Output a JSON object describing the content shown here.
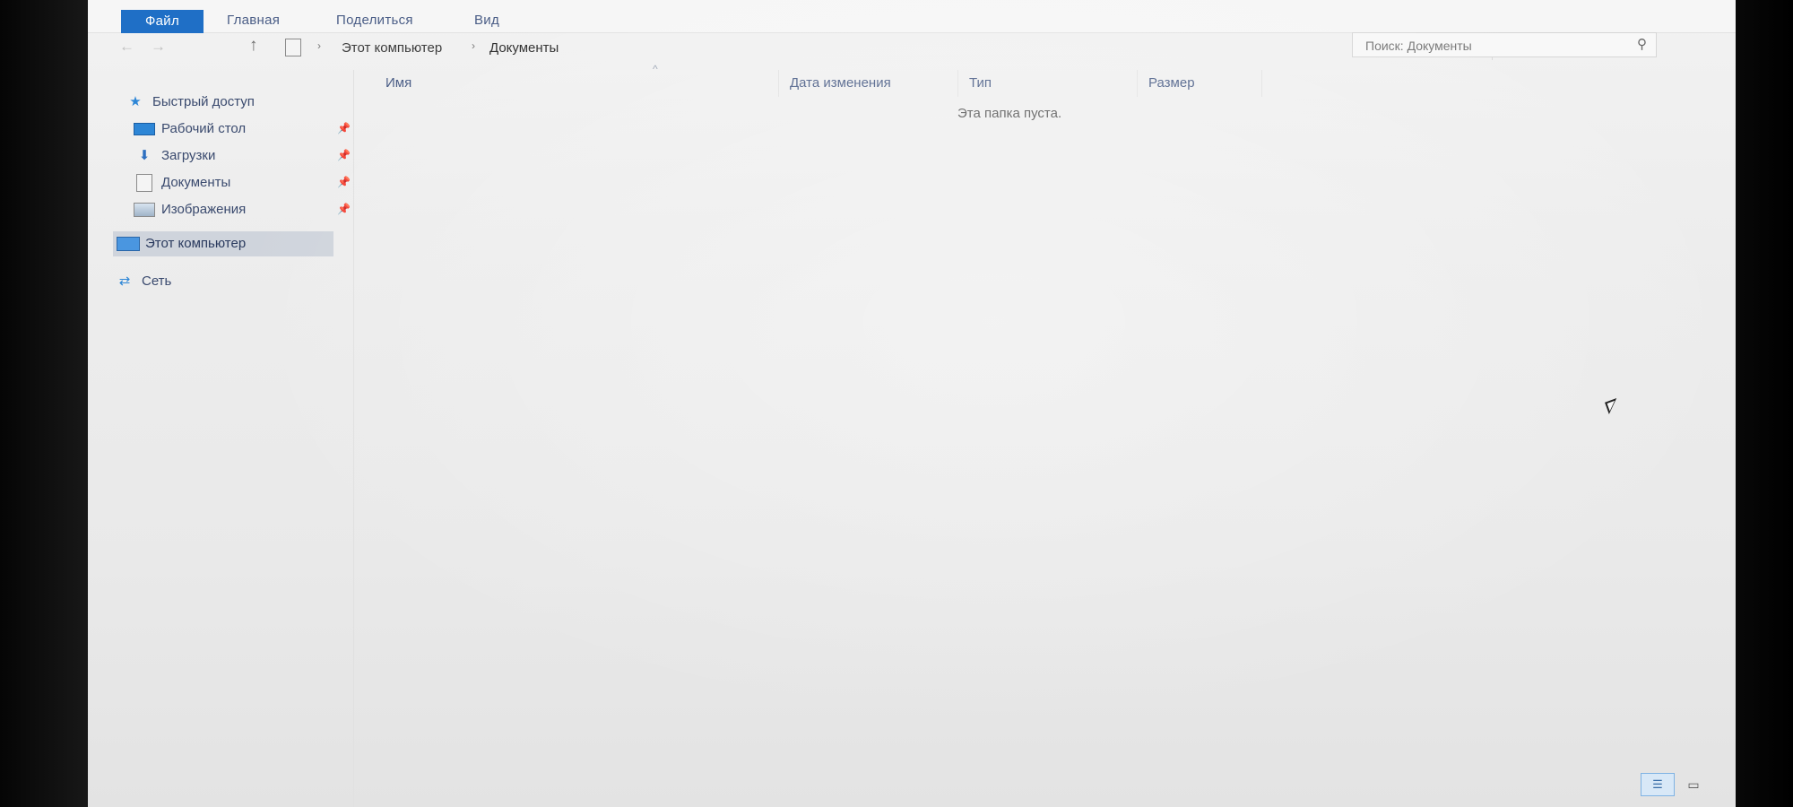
{
  "ribbon": {
    "tabs": [
      "Файл",
      "Главная",
      "Поделиться",
      "Вид"
    ]
  },
  "address": {
    "crumbs": [
      "Этот компьютер",
      "Документы"
    ],
    "separator": "›"
  },
  "search": {
    "placeholder": "Поиск: Документы"
  },
  "navpane": {
    "quick_access": "Быстрый доступ",
    "desktop": "Рабочий стол",
    "downloads": "Загрузки",
    "documents": "Документы",
    "pictures": "Изображения",
    "this_pc": "Этот компьютер",
    "network": "Сеть"
  },
  "columns": {
    "name": "Имя",
    "date": "Дата изменения",
    "type": "Тип",
    "size": "Размер"
  },
  "content": {
    "empty_message": "Эта папка пуста."
  },
  "icons": {
    "back": "←",
    "forward": "→",
    "up": "↑",
    "chevron": "⌄",
    "refresh": "↻",
    "search": "⚲",
    "pin": "📌",
    "star": "★",
    "download": "⬇",
    "network": "⇄",
    "sort": "^",
    "details": "☰",
    "large": "▭"
  }
}
